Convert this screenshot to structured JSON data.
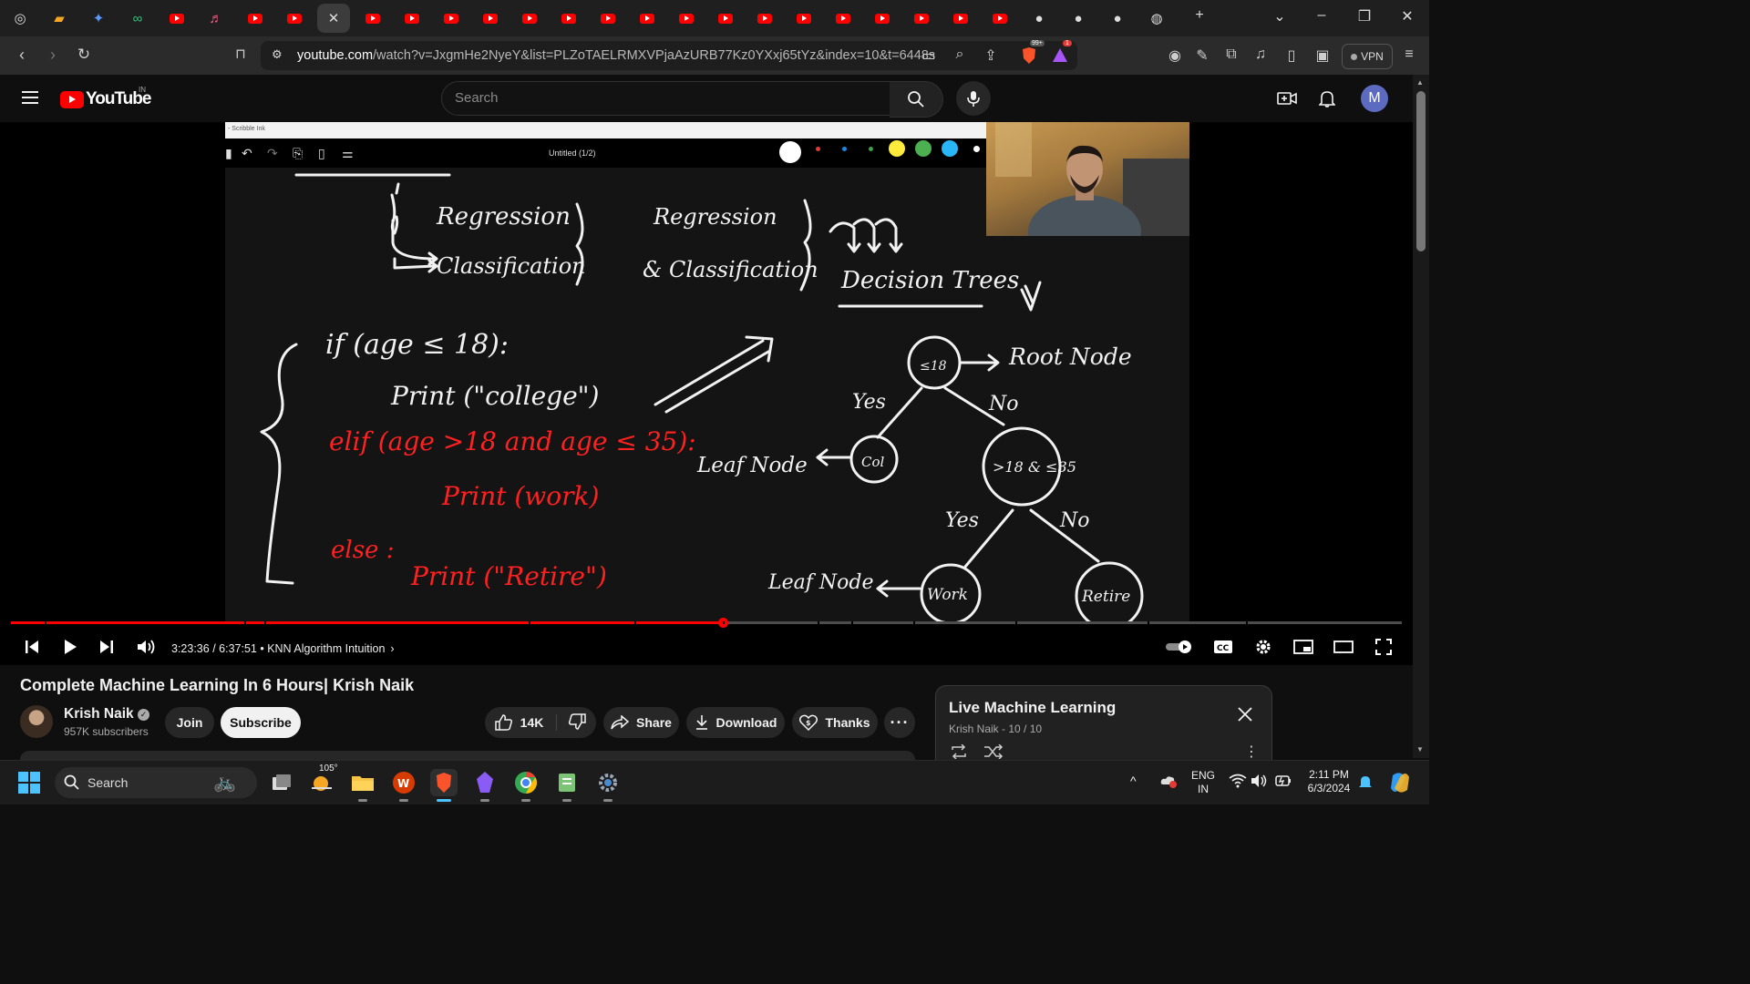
{
  "browser": {
    "tabs": [
      {
        "icon": "chatgpt-icon"
      },
      {
        "icon": "notes-icon"
      },
      {
        "icon": "gemini-icon"
      },
      {
        "icon": "copilot-icon"
      },
      {
        "icon": "youtube-icon"
      },
      {
        "icon": "music-icon"
      },
      {
        "icon": "youtube-icon"
      },
      {
        "icon": "youtube-icon"
      },
      {
        "icon": "close-icon",
        "active": true
      },
      {
        "icon": "youtube-icon"
      },
      {
        "icon": "youtube-icon"
      },
      {
        "icon": "youtube-icon"
      },
      {
        "icon": "youtube-icon"
      },
      {
        "icon": "youtube-icon"
      },
      {
        "icon": "youtube-icon"
      },
      {
        "icon": "youtube-icon"
      },
      {
        "icon": "youtube-icon"
      },
      {
        "icon": "youtube-icon"
      },
      {
        "icon": "youtube-icon"
      },
      {
        "icon": "youtube-icon"
      },
      {
        "icon": "youtube-icon"
      },
      {
        "icon": "youtube-icon"
      },
      {
        "icon": "youtube-icon"
      },
      {
        "icon": "youtube-icon"
      },
      {
        "icon": "youtube-icon"
      },
      {
        "icon": "youtube-icon"
      },
      {
        "icon": "github-icon"
      },
      {
        "icon": "github-icon"
      },
      {
        "icon": "github-icon"
      },
      {
        "icon": "globe-icon"
      }
    ],
    "url_domain": "youtube.com",
    "url_rest": "/watch?v=JxgmHe2NyeY&list=PLZoTAELRMXVPjaAzURB77Kz0YXxj65tYz&index=10&t=6448s",
    "brave_badge": "99+",
    "alert_badge": "1",
    "vpn_label": "VPN"
  },
  "youtube": {
    "logo_text": "YouTube",
    "country_code": "IN",
    "search_placeholder": "Search",
    "avatar_letter": "M"
  },
  "player": {
    "app_title": "- Scribble Ink",
    "doc_title": "Untitled (1/2)",
    "time_current": "3:23:36",
    "time_total": "6:37:51",
    "chapter": "KNN Algorithm Intuition",
    "progress_fraction": 0.512,
    "pen_colors": [
      "#e53935",
      "#1e88e5",
      "#43a047",
      "#ffeb3b",
      "#4caf50",
      "#29b6f6",
      "#ffffff"
    ]
  },
  "ink": {
    "regression_1": "Regression",
    "classification_1": "Classification",
    "regression_2": "Regression",
    "classification_2": "& Classification",
    "decision_trees": "Decision Trees",
    "if_line": "if (age ≤ 18):",
    "print_college": "Print (\"college\")",
    "elif_line": "elif (age >18 and age ≤ 35):",
    "print_work": "Print (work)",
    "else_line": "else :",
    "print_retire": "Print (\"Retire\")",
    "node_root": "≤18",
    "root_label": "Root Node",
    "yes_1": "Yes",
    "no_1": "No",
    "node_col": "Col",
    "leaf_1": "Leaf Node",
    "node_mid": ">18 & ≤35",
    "yes_2": "Yes",
    "no_2": "No",
    "leaf_2": "Leaf Node",
    "node_work": "Work",
    "node_retire": "Retire"
  },
  "video": {
    "title": "Complete Machine Learning In 6 Hours| Krish Naik",
    "channel": "Krish Naik",
    "subscribers": "957K subscribers",
    "join_label": "Join",
    "subscribe_label": "Subscribe",
    "likes": "14K",
    "share_label": "Share",
    "download_label": "Download",
    "thanks_label": "Thanks"
  },
  "playlist": {
    "title": "Live Machine Learning",
    "owner_position": "Krish Naik - 10 / 10"
  },
  "taskbar": {
    "search_label": "Search",
    "weather": "105°",
    "lang_1": "ENG",
    "lang_2": "IN",
    "time": "2:11 PM",
    "date": "6/3/2024"
  }
}
